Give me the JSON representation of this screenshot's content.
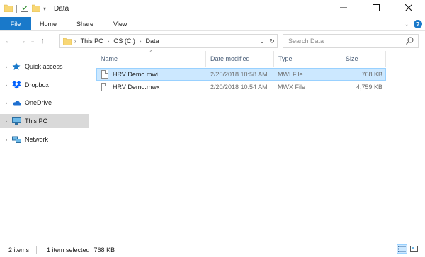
{
  "window": {
    "title": "Data",
    "buttons": [
      "minimize-icon",
      "maximize-icon",
      "close-icon"
    ]
  },
  "ribbon": {
    "tabs": [
      "File",
      "Home",
      "Share",
      "View"
    ]
  },
  "address": {
    "crumbs": [
      "This PC",
      "OS (C:)",
      "Data"
    ]
  },
  "search": {
    "placeholder": "Search Data"
  },
  "nav": {
    "items": [
      {
        "label": "Quick access",
        "icon": "star-icon"
      },
      {
        "label": "Dropbox",
        "icon": "dropbox-icon"
      },
      {
        "label": "OneDrive",
        "icon": "cloud-icon"
      },
      {
        "label": "This PC",
        "icon": "computer-icon"
      },
      {
        "label": "Network",
        "icon": "network-icon"
      }
    ]
  },
  "columns": [
    "Name",
    "Date modified",
    "Type",
    "Size"
  ],
  "files": [
    {
      "name": "HRV Demo.mwi",
      "date": "2/20/2018 10:58 AM",
      "type": "MWI File",
      "size": "768 KB",
      "selected": true
    },
    {
      "name": "HRV Demo.mwx",
      "date": "2/20/2018 10:54 AM",
      "type": "MWX File",
      "size": "4,759 KB",
      "selected": false
    }
  ],
  "status": {
    "count": "2 items",
    "selected": "1 item selected",
    "size": "768 KB"
  },
  "colors": {
    "accent": "#1979ca",
    "selection": "#cce8ff",
    "folder": "#f8d775"
  }
}
